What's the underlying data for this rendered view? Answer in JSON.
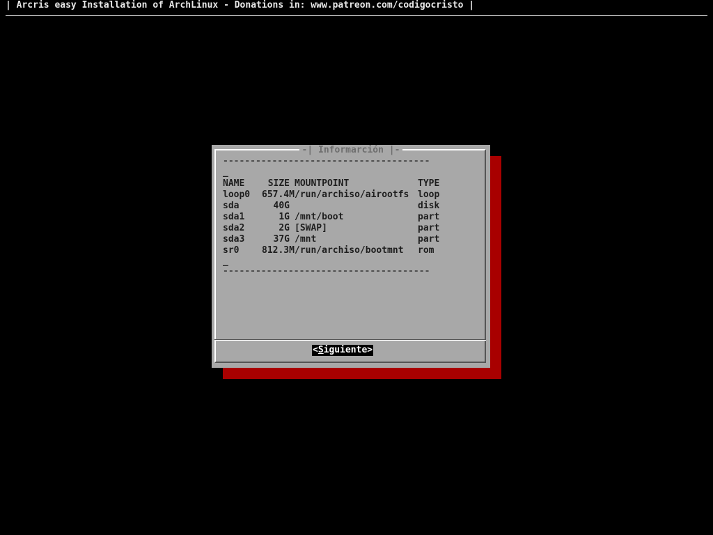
{
  "backtitle": "| Arcris easy Installation of ArchLinux - Donations in: www.patreon.com/codigocristo |",
  "dialog": {
    "title": "-| Informarción |-",
    "separator": "--------------------------------------",
    "cursor": "_",
    "table": {
      "headers": {
        "name": "NAME",
        "size": "SIZE",
        "mountpoint": "MOUNTPOINT",
        "type": "TYPE"
      },
      "rows": [
        {
          "name": "loop0",
          "size": "657.4M",
          "mountpoint": "/run/archiso/airootfs",
          "type": "loop"
        },
        {
          "name": "sda",
          "size": "40G",
          "mountpoint": "",
          "type": "disk"
        },
        {
          "name": "sda1",
          "size": "1G",
          "mountpoint": "/mnt/boot",
          "type": "part"
        },
        {
          "name": "sda2",
          "size": "2G",
          "mountpoint": "[SWAP]",
          "type": "part"
        },
        {
          "name": "sda3",
          "size": "37G",
          "mountpoint": "/mnt",
          "type": "part"
        },
        {
          "name": "sr0",
          "size": "812.3M",
          "mountpoint": "/run/archiso/bootmnt",
          "type": "rom"
        }
      ]
    },
    "button": {
      "open": "<",
      "hotkey": "S",
      "rest": "iguiente",
      "close": ">"
    }
  },
  "colors": {
    "screen_bg": "#000000",
    "dialog_bg": "#a8a8a8",
    "shadow": "#a80000",
    "button_bg": "#000000",
    "button_fg": "#ffffff"
  }
}
